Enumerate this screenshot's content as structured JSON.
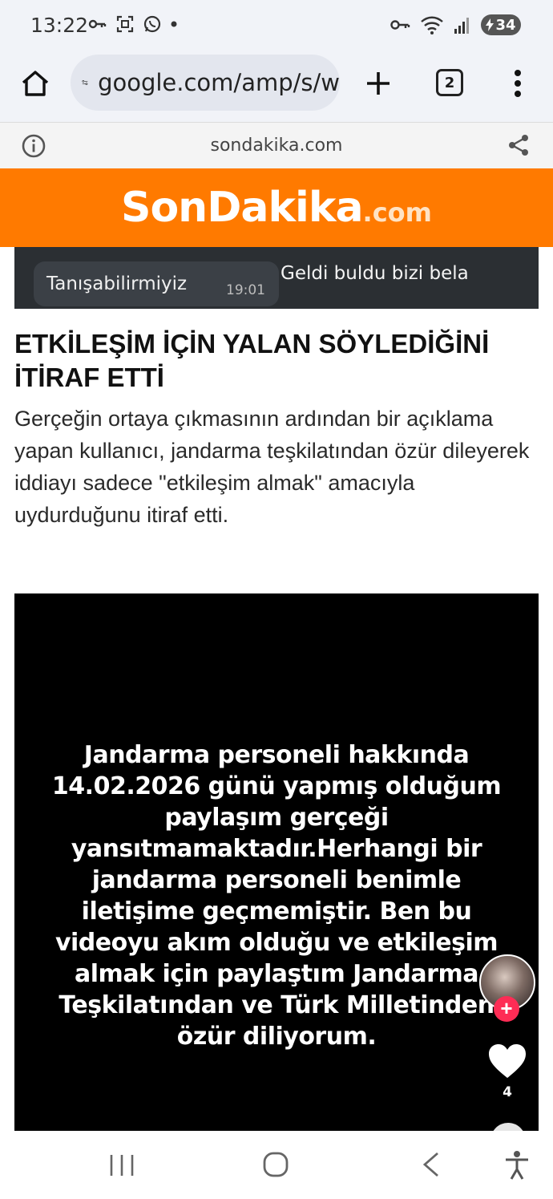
{
  "status_bar": {
    "time": "13:22",
    "battery": "34"
  },
  "browser": {
    "url": "google.com/amp/s/w",
    "tab_count": "2"
  },
  "amp_header": {
    "domain": "sondakika.com"
  },
  "site": {
    "logo_main": "SonDakika",
    "logo_tld": ".com",
    "brand_color": "#ff7a00"
  },
  "top_image": {
    "received_text": "Tanışabilirmiyiz",
    "received_time": "19:01",
    "sent_text": "Geldi buldu bizi bela"
  },
  "article": {
    "headline": "ETKİLEŞİM İÇİN YALAN SÖYLEDİĞİNİ İTİRAF ETTİ",
    "paragraph": "Gerçeğin ortaya çıkmasının ardından bir açıklama yapan kullanıcı, jandarma teşkilatından özür dileyerek iddiayı sadece \"etkileşim almak\" amacıyla uydurduğunu itiraf etti."
  },
  "video": {
    "caption": "Jandarma personeli hakkında 14.02.2026 günü yapmış olduğum paylaşım gerçeği yansıtmamaktadır.Herhangi bir jandarma personeli benimle iletişime geçmemiştir. Ben bu videoyu akım olduğu ve etkileşim almak için paylaştım  Jandarma Teşkilatından ve Türk  Milletinden özür diliyorum.",
    "follow_symbol": "+",
    "like_count": "4"
  },
  "icons": {
    "status_left": [
      "key-icon",
      "screenshot-icon",
      "whatsapp-icon",
      "dot-icon"
    ],
    "status_right": [
      "vpn-key-icon",
      "wifi-icon",
      "signal-icon",
      "battery-icon"
    ],
    "toolbar": [
      "home-icon",
      "site-settings-icon",
      "plus-icon",
      "tab-switcher-icon",
      "more-vert-icon"
    ],
    "amp": [
      "info-icon",
      "share-icon"
    ],
    "nav": [
      "recents-icon",
      "home-circle-icon",
      "back-icon",
      "accessibility-icon"
    ]
  }
}
